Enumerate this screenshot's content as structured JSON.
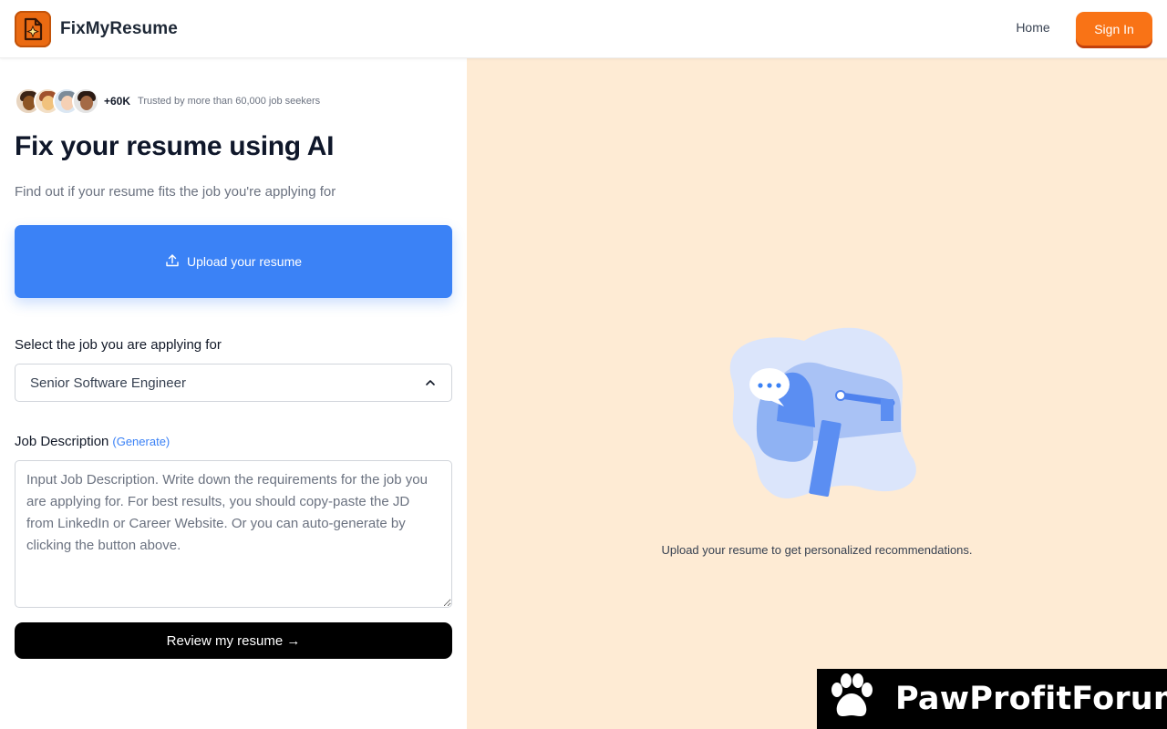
{
  "header": {
    "brand_name": "FixMyResume",
    "nav_home": "Home",
    "sign_in": "Sign In"
  },
  "trust": {
    "count": "+60K",
    "text": "Trusted by more than 60,000 job seekers"
  },
  "hero": {
    "title": "Fix your resume using AI",
    "subtitle": "Find out if your resume fits the job you're applying for"
  },
  "upload": {
    "label": "Upload your resume"
  },
  "job_select": {
    "label": "Select the job you are applying for",
    "selected": "Senior Software Engineer"
  },
  "job_description": {
    "label": "Job Description",
    "generate_link": "(Generate)",
    "placeholder": "Input Job Description. Write down the requirements for the job you are applying for. For best results, you should copy-paste the JD from LinkedIn or Career Website. Or you can auto-generate by clicking the button above.",
    "value": ""
  },
  "review_button": {
    "label": "Review my resume →"
  },
  "right_panel": {
    "message": "Upload your resume to get personalized recommendations."
  },
  "watermark": {
    "text": "PawProfitForum"
  },
  "colors": {
    "brand_orange": "#f97316",
    "upload_blue": "#3b82f6",
    "right_panel_bg": "#feebd4"
  },
  "icons": {
    "logo": "document-sparkle-icon",
    "upload": "upload-icon",
    "select": "chevron-up-icon",
    "illustration": "mailbox-chat-icon",
    "watermark": "paw-icon"
  }
}
